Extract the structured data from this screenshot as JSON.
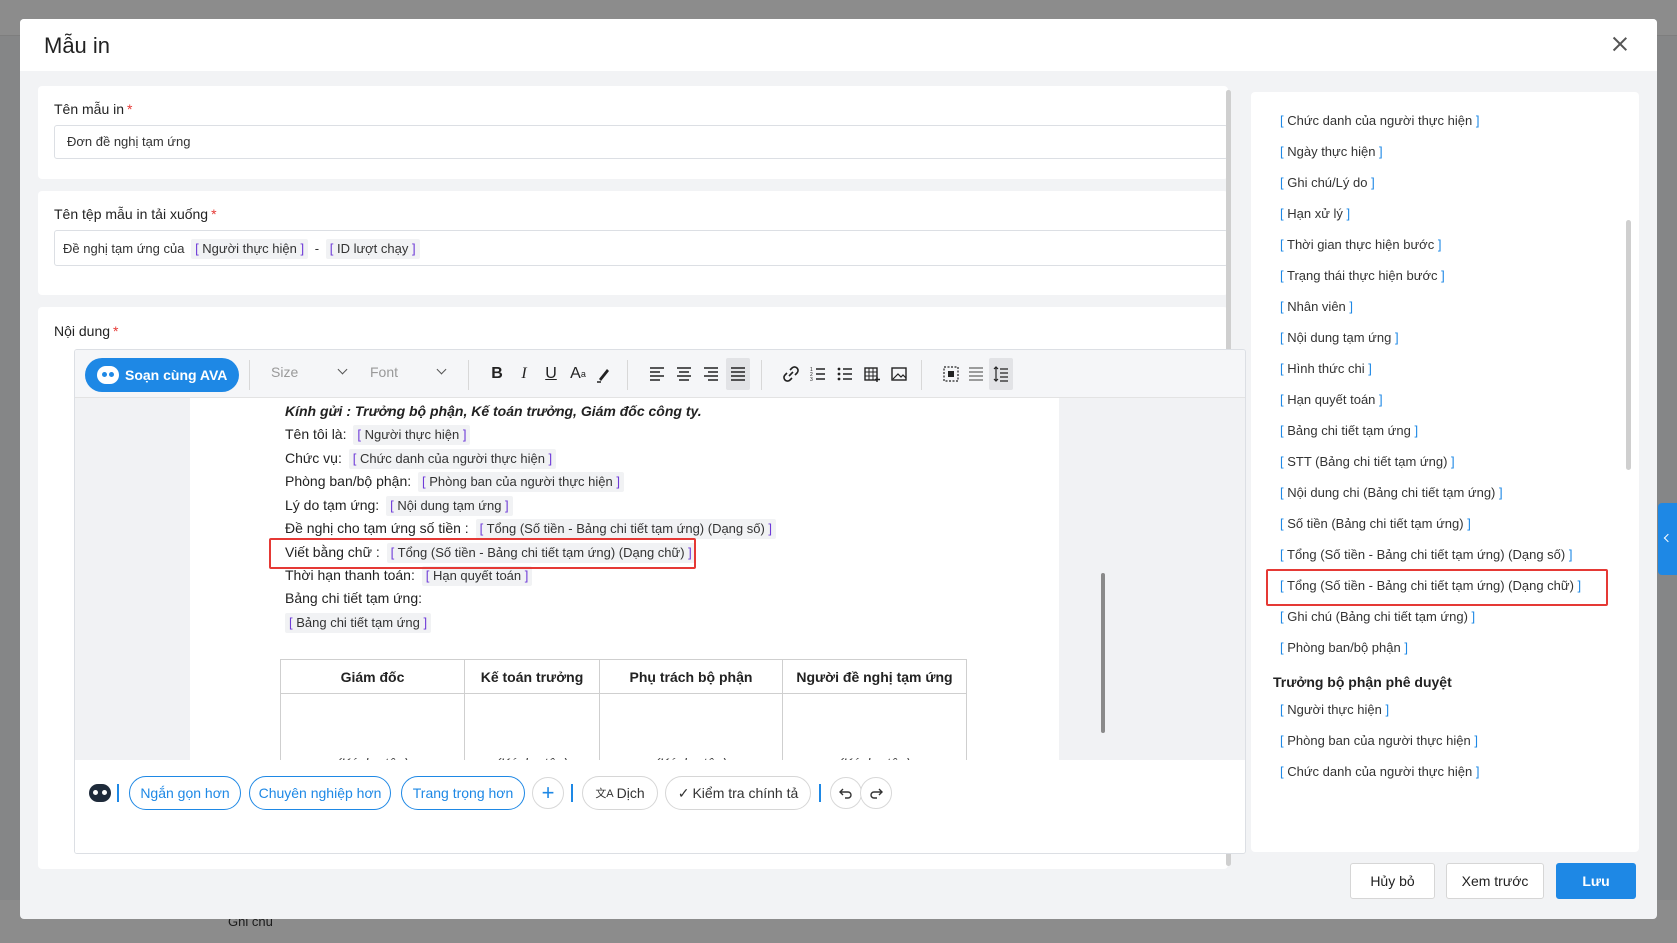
{
  "modal": {
    "title": "Mẫu in"
  },
  "template_name": {
    "label": "Tên mẫu in",
    "required_mark": "*",
    "value": "Đơn đề nghị tạm ứng"
  },
  "file_name": {
    "label": "Tên tệp mẫu in tải xuống",
    "required_mark": "*",
    "prefix_text": "Đề nghị tạm ứng của",
    "tag_1": "Người thực hiện",
    "separator": "-",
    "tag_2": "ID lượt chạy"
  },
  "content": {
    "label": "Nội dung",
    "required_mark": "*"
  },
  "toolbar": {
    "ava_button": "Soạn cùng AVA",
    "size_placeholder": "Size",
    "font_placeholder": "Font",
    "bold": "B",
    "italic": "I",
    "underline": "U",
    "font_size": "A"
  },
  "document": {
    "greeting": "Kính gửi : Trưởng bộ phận, Kế toán trưởng, Giám đốc công ty.",
    "lines": [
      {
        "label": "Tên tôi là:",
        "tag": "Người thực hiện"
      },
      {
        "label": "Chức vụ:",
        "tag": "Chức danh của người thực hiện"
      },
      {
        "label": "Phòng ban/bộ phận:",
        "tag": "Phòng ban của người thực hiện"
      },
      {
        "label": "Lý do tạm ứng:",
        "tag": "Nội dung tạm ứng"
      },
      {
        "label": "Đề nghị cho tạm ứng số tiền :",
        "tag": "Tổng (Số tiền - Bảng chi tiết tạm ứng) (Dạng số)"
      },
      {
        "label": "Viết bằng chữ :",
        "tag": "Tổng (Số tiền - Bảng chi tiết tạm ứng) (Dạng chữ)"
      },
      {
        "label": "Thời hạn thanh toán:",
        "tag": "Hạn quyết toán"
      },
      {
        "label": "Bảng chi tiết tạm ứng:",
        "tag": ""
      }
    ],
    "table_tag": "Bảng chi tiết tạm ứng",
    "signature_headers": [
      "Giám đốc",
      "Kế toán trưởng",
      "Phụ trách bộ phận",
      "Người đề nghị tạm ứng"
    ],
    "signature_note": "(Ký, họ tên)"
  },
  "ai_bar": {
    "shorter": "Ngắn gọn hơn",
    "professional": "Chuyên nghiệp hơn",
    "formal": "Trang trọng hơn",
    "add": "+",
    "translate": "Dịch",
    "spellcheck": "Kiểm tra chính tả"
  },
  "right_panel": {
    "fields_group_1": [
      "Chức danh của người thực hiện",
      "Ngày thực hiện",
      "Ghi chú/Lý do",
      "Hạn xử lý",
      "Thời gian thực hiện bước",
      "Trạng thái thực hiện bước",
      "Nhân viên",
      "Nội dung tạm ứng",
      "Hình thức chi",
      "Hạn quyết toán",
      "Bảng chi tiết tạm ứng",
      "STT (Bảng chi tiết tạm ứng)",
      "Nội dung chi (Bảng chi tiết tạm ứng)",
      "Số tiền (Bảng chi tiết tạm ứng)",
      "Tổng (Số tiền - Bảng chi tiết tạm ứng) (Dạng số)",
      "Tổng (Số tiền - Bảng chi tiết tạm ứng) (Dạng chữ)",
      "Ghi chú (Bảng chi tiết tạm ứng)",
      "Phòng ban/bộ phận"
    ],
    "section_title": "Trưởng bộ phận phê duyệt",
    "fields_group_2": [
      "Người thực hiện",
      "Phòng ban của người thực hiện",
      "Chức danh của người thực hiện"
    ]
  },
  "footer": {
    "cancel": "Hủy bỏ",
    "preview": "Xem trước",
    "save": "Lưu"
  },
  "background": {
    "bottom_text": "Ghi chú"
  },
  "colors": {
    "accent": "#1e88e5",
    "tag_bracket_editor": "#6e3bd8",
    "highlight": "#e53935"
  }
}
